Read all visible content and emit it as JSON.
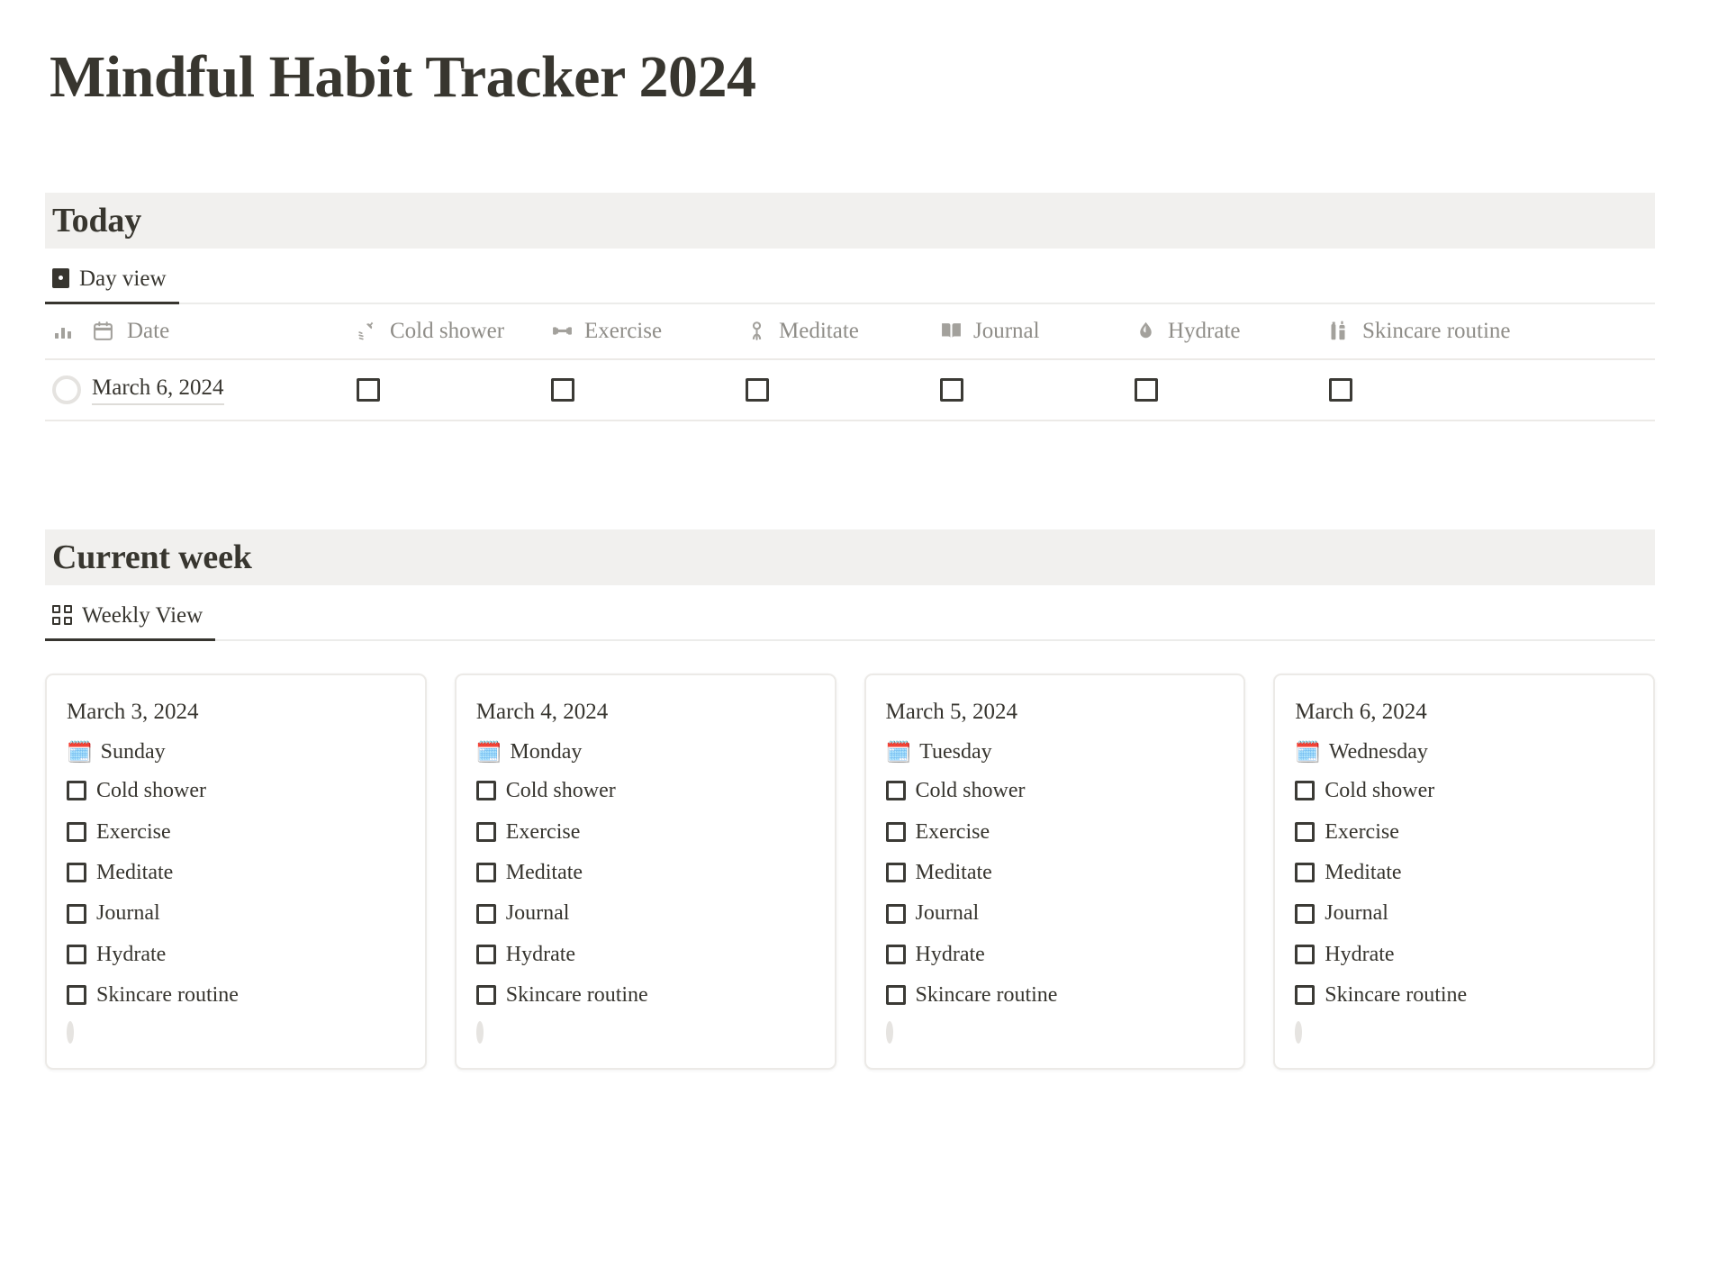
{
  "page": {
    "title": "Mindful Habit Tracker 2024",
    "background_color": "#ffffff",
    "text_color": "#37352f",
    "band_color": "#f1f0ee",
    "muted_color": "#8f8d88"
  },
  "today_section": {
    "heading": "Today",
    "tab": {
      "label": "Day view",
      "icon": "day-view-icon",
      "active": true
    },
    "columns": [
      {
        "label": "Date",
        "icon": "calendar-icon"
      },
      {
        "label": "Cold shower",
        "icon": "shower-icon"
      },
      {
        "label": "Exercise",
        "icon": "dumbbell-icon"
      },
      {
        "label": "Meditate",
        "icon": "meditation-icon"
      },
      {
        "label": "Journal",
        "icon": "book-icon"
      },
      {
        "label": "Hydrate",
        "icon": "water-drop-icon"
      },
      {
        "label": "Skincare routine",
        "icon": "bottles-icon"
      }
    ],
    "row_icon": "bar-chart-icon",
    "rows": [
      {
        "date": "March 6, 2024",
        "progress": 0,
        "checks": [
          false,
          false,
          false,
          false,
          false,
          false
        ]
      }
    ]
  },
  "week_section": {
    "heading": "Current week",
    "tab": {
      "label": "Weekly View",
      "icon": "grid-view-icon",
      "active": true
    },
    "day_emoji": "🗓️",
    "cards": [
      {
        "date": "March 3, 2024",
        "day": "Sunday",
        "progress": 0,
        "habits": [
          {
            "label": "Cold shower",
            "checked": false
          },
          {
            "label": "Exercise",
            "checked": false
          },
          {
            "label": "Meditate",
            "checked": false
          },
          {
            "label": "Journal",
            "checked": false
          },
          {
            "label": "Hydrate",
            "checked": false
          },
          {
            "label": "Skincare routine",
            "checked": false
          }
        ]
      },
      {
        "date": "March 4, 2024",
        "day": "Monday",
        "progress": 0,
        "habits": [
          {
            "label": "Cold shower",
            "checked": false
          },
          {
            "label": "Exercise",
            "checked": false
          },
          {
            "label": "Meditate",
            "checked": false
          },
          {
            "label": "Journal",
            "checked": false
          },
          {
            "label": "Hydrate",
            "checked": false
          },
          {
            "label": "Skincare routine",
            "checked": false
          }
        ]
      },
      {
        "date": "March 5, 2024",
        "day": "Tuesday",
        "progress": 0,
        "habits": [
          {
            "label": "Cold shower",
            "checked": false
          },
          {
            "label": "Exercise",
            "checked": false
          },
          {
            "label": "Meditate",
            "checked": false
          },
          {
            "label": "Journal",
            "checked": false
          },
          {
            "label": "Hydrate",
            "checked": false
          },
          {
            "label": "Skincare routine",
            "checked": false
          }
        ]
      },
      {
        "date": "March 6, 2024",
        "day": "Wednesday",
        "progress": 0,
        "habits": [
          {
            "label": "Cold shower",
            "checked": false
          },
          {
            "label": "Exercise",
            "checked": false
          },
          {
            "label": "Meditate",
            "checked": false
          },
          {
            "label": "Journal",
            "checked": false
          },
          {
            "label": "Hydrate",
            "checked": false
          },
          {
            "label": "Skincare routine",
            "checked": false
          }
        ]
      }
    ]
  }
}
